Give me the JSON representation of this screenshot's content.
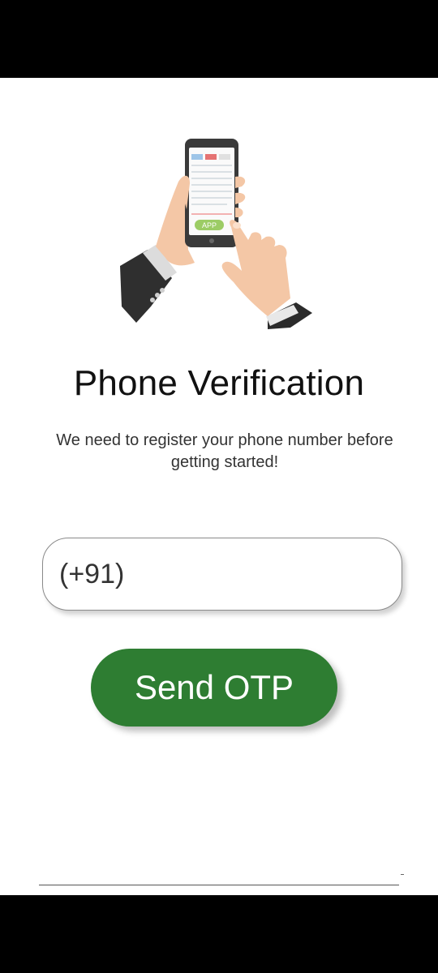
{
  "page": {
    "title": "Phone Verification",
    "subtitle": "We need to register your phone number before getting started!"
  },
  "illustration": {
    "icon": "hand-holding-phone-illustration",
    "app_label": "APP"
  },
  "phone_input": {
    "country_code": "(+91)",
    "value": "",
    "placeholder": ""
  },
  "actions": {
    "send_otp_label": "Send OTP"
  },
  "colors": {
    "accent": "#2e7d32",
    "background": "#ffffff",
    "input_border": "#8a8a8a"
  }
}
